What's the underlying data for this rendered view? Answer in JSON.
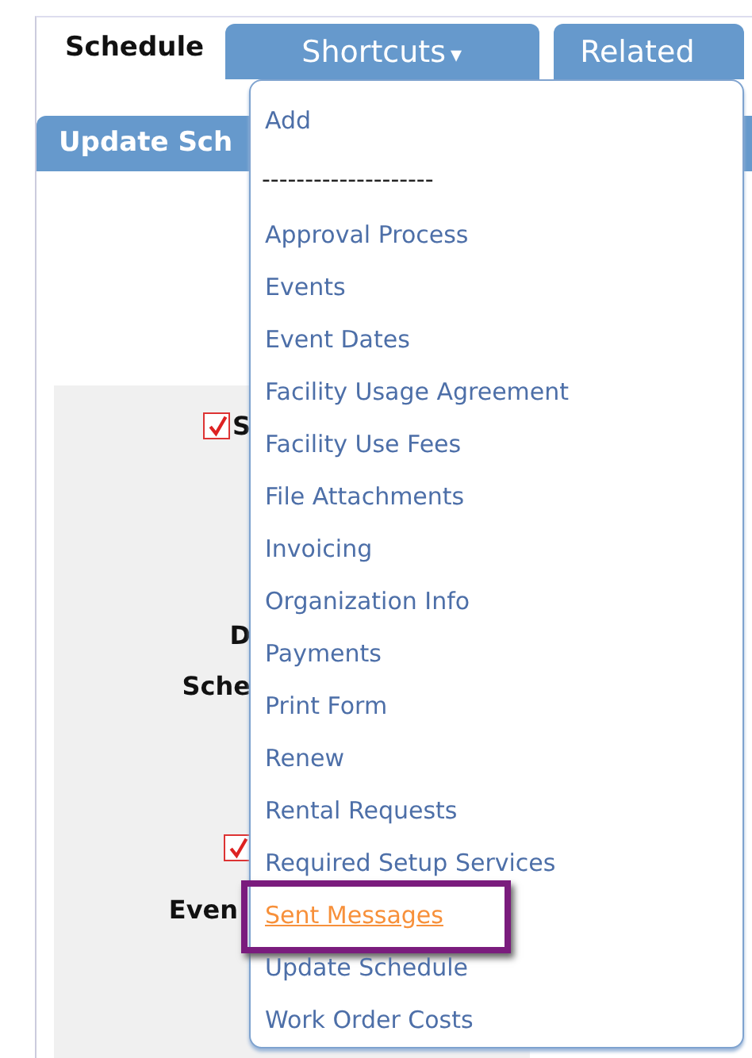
{
  "page_title": "Schedule",
  "tabs": [
    {
      "label": "Shortcuts",
      "caret": "▾",
      "open": true
    },
    {
      "label": "Related",
      "open": false
    }
  ],
  "section_header": "Update Sch",
  "form_labels": [
    {
      "text": "S",
      "checked": true
    },
    {
      "text": "D"
    },
    {
      "text": "Sche"
    },
    {
      "checked": true
    },
    {
      "text": "Even"
    }
  ],
  "menu": {
    "items": [
      {
        "kind": "link",
        "label": "Add",
        "selected": false
      },
      {
        "kind": "separator",
        "label": "--------------------"
      },
      {
        "kind": "link",
        "label": "Approval Process",
        "selected": false
      },
      {
        "kind": "link",
        "label": "Events",
        "selected": false
      },
      {
        "kind": "link",
        "label": "Event Dates",
        "selected": false
      },
      {
        "kind": "link",
        "label": "Facility Usage Agreement",
        "selected": false
      },
      {
        "kind": "link",
        "label": "Facility Use Fees",
        "selected": false
      },
      {
        "kind": "link",
        "label": "File Attachments",
        "selected": false
      },
      {
        "kind": "link",
        "label": "Invoicing",
        "selected": false
      },
      {
        "kind": "link",
        "label": "Organization Info",
        "selected": false
      },
      {
        "kind": "link",
        "label": "Payments",
        "selected": false
      },
      {
        "kind": "link",
        "label": "Print Form",
        "selected": false
      },
      {
        "kind": "link",
        "label": "Renew",
        "selected": false
      },
      {
        "kind": "link",
        "label": "Rental Requests",
        "selected": false
      },
      {
        "kind": "link",
        "label": "Required Setup Services",
        "selected": false
      },
      {
        "kind": "link",
        "label": "Sent Messages",
        "selected": true
      },
      {
        "kind": "link",
        "label": "Update Schedule",
        "selected": false
      },
      {
        "kind": "link",
        "label": "Work Order Costs",
        "selected": false
      }
    ]
  }
}
